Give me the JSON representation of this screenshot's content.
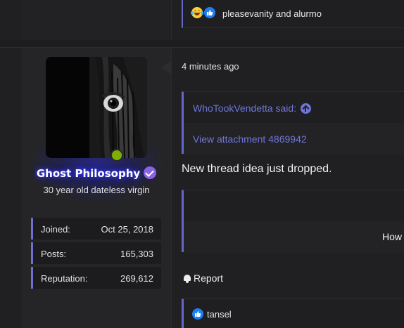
{
  "previous_post": {
    "reactions": {
      "icons": [
        "laughing-emoji-icon",
        "thumbs-up-icon"
      ],
      "names": "pleasevanity and alurmo"
    }
  },
  "post": {
    "user": {
      "username": "Ghost Philosophy",
      "user_title": "30 year old dateless virgin",
      "online_status_color": "#7fb000",
      "name_glow_color": "#3c3cff",
      "verified_badge_color": "#8a63e8",
      "stats": [
        {
          "label": "Joined:",
          "value": "Oct 25, 2018"
        },
        {
          "label": "Posts:",
          "value": "165,303"
        },
        {
          "label": "Reputation:",
          "value": "269,612"
        }
      ]
    },
    "timestamp": "4 minutes ago",
    "quote": {
      "author": "WhoTookVendetta said:",
      "attachment_link": "View attachment 4869942"
    },
    "message": "New thread idea just dropped.",
    "embed": {
      "text": "How"
    },
    "report_label": "Report",
    "reactions": {
      "icons": [
        "thumbs-up-icon"
      ],
      "names": "tansel"
    }
  },
  "colors": {
    "accent": "#6468c8",
    "link": "#7075d8",
    "background": "#1d1d1f"
  }
}
